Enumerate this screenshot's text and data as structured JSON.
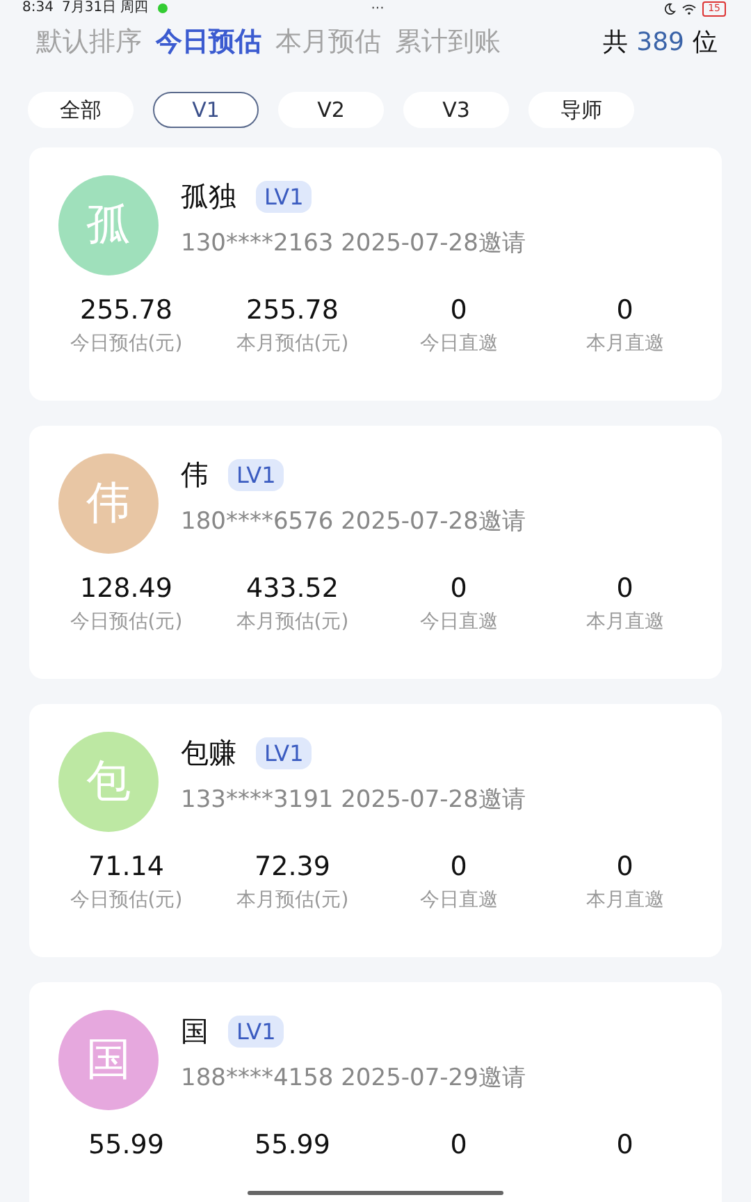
{
  "status_bar": {
    "time": "8:34",
    "date": "7月31日 周四",
    "more": "···",
    "battery": "15"
  },
  "sort_tabs": [
    {
      "label": "默认排序",
      "selected": false
    },
    {
      "label": "今日预估",
      "selected": true
    },
    {
      "label": "本月预估",
      "selected": false
    },
    {
      "label": "累计到账",
      "selected": false
    }
  ],
  "total": {
    "prefix": "共",
    "count": "389",
    "suffix": "位"
  },
  "level_filters": [
    {
      "label": "全部",
      "selected": false
    },
    {
      "label": "V1",
      "selected": true
    },
    {
      "label": "V2",
      "selected": false
    },
    {
      "label": "V3",
      "selected": false
    },
    {
      "label": "导师",
      "selected": false
    }
  ],
  "members": [
    {
      "avatar": "孤",
      "color": "#9fe0bb",
      "name": "孤独",
      "level": "LV1",
      "info": "130****2163 2025-07-28邀请",
      "stats": [
        {
          "value": "255.78",
          "label": "今日预估(元)"
        },
        {
          "value": "255.78",
          "label": "本月预估(元)"
        },
        {
          "value": "0",
          "label": "今日直邀"
        },
        {
          "value": "0",
          "label": "本月直邀"
        }
      ]
    },
    {
      "avatar": "伟",
      "color": "#e8c6a4",
      "name": "伟",
      "level": "LV1",
      "info": "180****6576 2025-07-28邀请",
      "stats": [
        {
          "value": "128.49",
          "label": "今日预估(元)"
        },
        {
          "value": "433.52",
          "label": "本月预估(元)"
        },
        {
          "value": "0",
          "label": "今日直邀"
        },
        {
          "value": "0",
          "label": "本月直邀"
        }
      ]
    },
    {
      "avatar": "包",
      "color": "#bde8a3",
      "name": "包赚",
      "level": "LV1",
      "info": "133****3191 2025-07-28邀请",
      "stats": [
        {
          "value": "71.14",
          "label": "今日预估(元)"
        },
        {
          "value": "72.39",
          "label": "本月预估(元)"
        },
        {
          "value": "0",
          "label": "今日直邀"
        },
        {
          "value": "0",
          "label": "本月直邀"
        }
      ]
    },
    {
      "avatar": "国",
      "color": "#e6a8de",
      "name": "国",
      "level": "LV1",
      "info": "188****4158 2025-07-29邀请",
      "stats": [
        {
          "value": "55.99"
        },
        {
          "value": "55.99"
        },
        {
          "value": "0"
        },
        {
          "value": "0"
        }
      ]
    }
  ]
}
